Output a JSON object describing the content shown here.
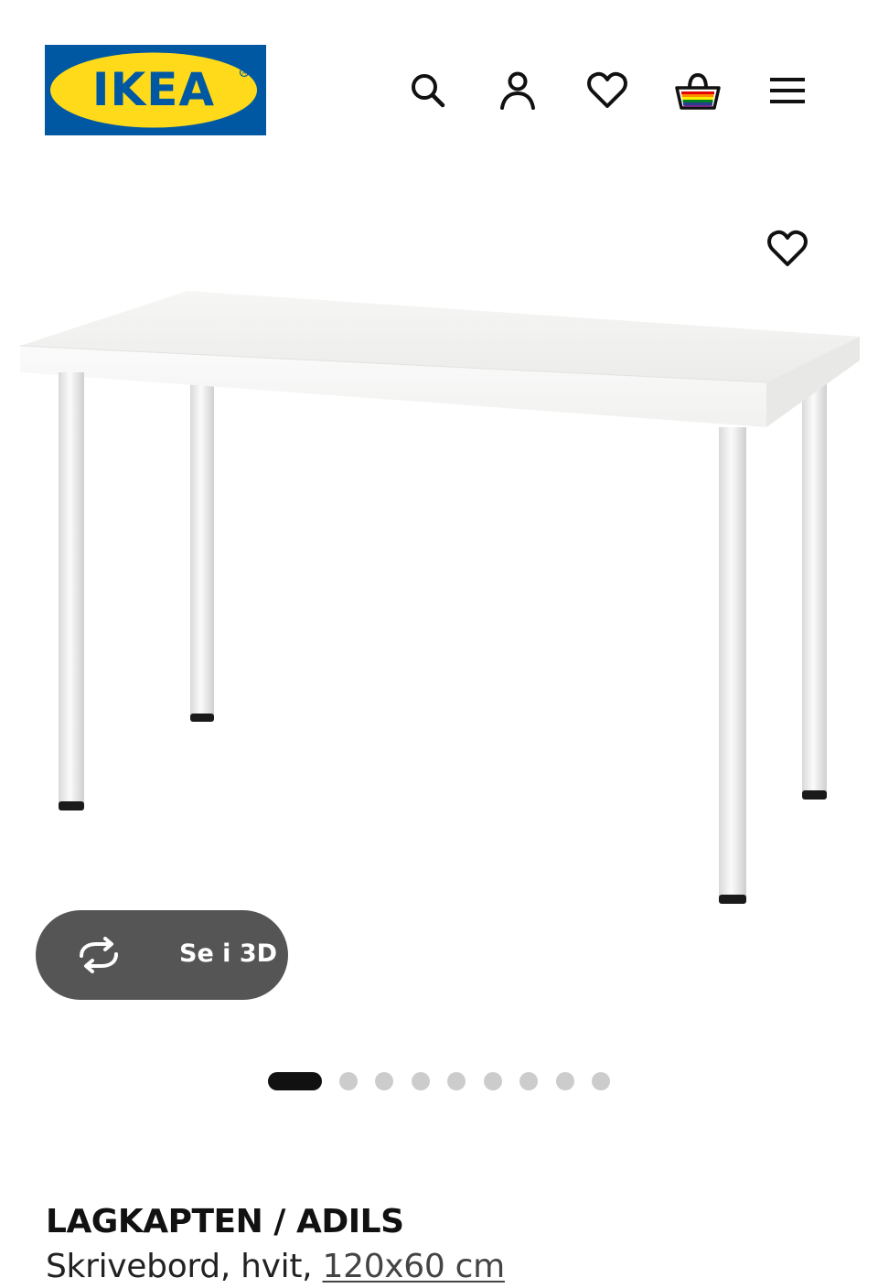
{
  "brand": {
    "logo_text": "IKEA",
    "colors": {
      "blue": "#0058A3",
      "yellow": "#FFDA1A"
    }
  },
  "header": {
    "icons": [
      "search-icon",
      "account-icon",
      "favourites-icon",
      "shopping-basket-icon",
      "menu-icon"
    ]
  },
  "gallery": {
    "view_3d_label": "Se i 3D",
    "image_count": 9,
    "active_index": 0
  },
  "product": {
    "name": "LAGKAPTEN / ADILS",
    "description_prefix": "Skrivebord, hvit,",
    "size": "120x60 cm"
  },
  "colors": {
    "button_bg": "#555555",
    "dot_active": "#111111",
    "dot_inactive": "#CCCCCC",
    "text": "#111111"
  }
}
